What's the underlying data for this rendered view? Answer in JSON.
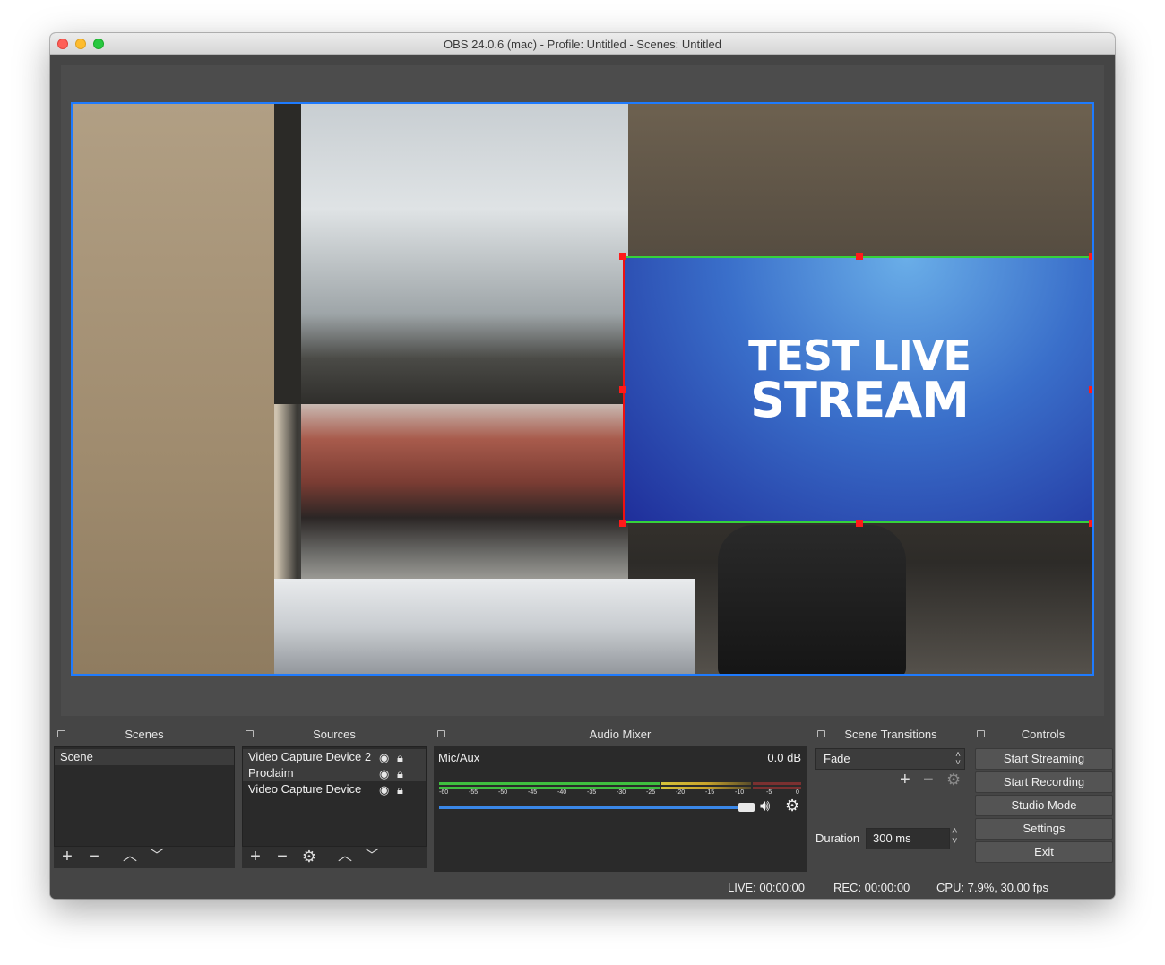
{
  "window": {
    "title": "OBS 24.0.6 (mac) - Profile: Untitled - Scenes: Untitled"
  },
  "preview": {
    "overlay_line1": "TEST LIVE",
    "overlay_line2": "STREAM"
  },
  "scenes": {
    "header": "Scenes",
    "items": [
      {
        "label": "Scene",
        "selected": true
      }
    ]
  },
  "sources": {
    "header": "Sources",
    "items": [
      {
        "label": "Video Capture Device 2"
      },
      {
        "label": "Proclaim"
      },
      {
        "label": "Video Capture Device"
      }
    ]
  },
  "audio_mixer": {
    "header": "Audio Mixer",
    "channel_name": "Mic/Aux",
    "level": "0.0 dB",
    "ticks": [
      "-60",
      "-55",
      "-50",
      "-45",
      "-40",
      "-35",
      "-30",
      "-25",
      "-20",
      "-15",
      "-10",
      "-5",
      "0"
    ]
  },
  "scene_transitions": {
    "header": "Scene Transitions",
    "transition": "Fade",
    "duration_label": "Duration",
    "duration_value": "300 ms"
  },
  "controls": {
    "header": "Controls",
    "buttons": [
      "Start Streaming",
      "Start Recording",
      "Studio Mode",
      "Settings",
      "Exit"
    ]
  },
  "status": {
    "live": "LIVE: 00:00:00",
    "rec": "REC: 00:00:00",
    "cpu": "CPU: 7.9%, 30.00 fps"
  },
  "colors": {
    "selection_border": "#1e7bff",
    "handle": "#ff1a1a",
    "volume_slider": "#3a87e8"
  }
}
